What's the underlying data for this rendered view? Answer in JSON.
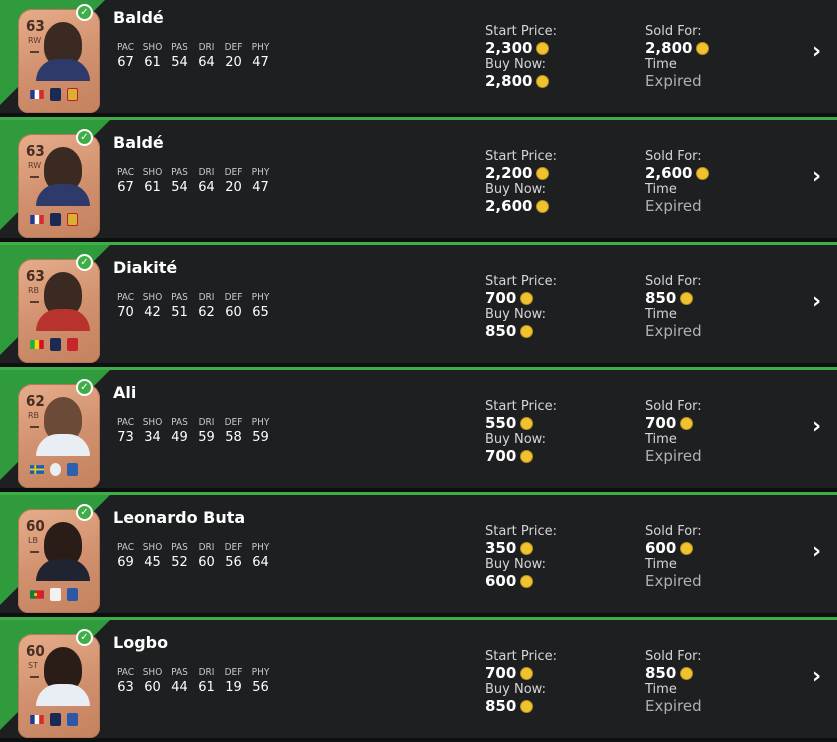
{
  "stat_labels": [
    "PAC",
    "SHO",
    "PAS",
    "DRI",
    "DEF",
    "PHY"
  ],
  "labels": {
    "start_price": "Start Price:",
    "buy_now": "Buy Now:",
    "sold_for": "Sold For:",
    "time": "Time"
  },
  "icons": {
    "coin": "coin-icon",
    "chevron": "chevron-right-icon",
    "check": "check-icon"
  },
  "colors": {
    "accent": "#3fae48",
    "row_bg": "#1d1f20",
    "coin": "#f0c230",
    "card": "#d9987a"
  },
  "items": [
    {
      "name": "Baldé",
      "rating": "63",
      "position": "RW",
      "stats": [
        "67",
        "61",
        "54",
        "64",
        "20",
        "47"
      ],
      "start_price": "2,300",
      "buy_now": "2,800",
      "sold_for": "2,800",
      "time": "Expired"
    },
    {
      "name": "Baldé",
      "rating": "63",
      "position": "RW",
      "stats": [
        "67",
        "61",
        "54",
        "64",
        "20",
        "47"
      ],
      "start_price": "2,200",
      "buy_now": "2,600",
      "sold_for": "2,600",
      "time": "Expired"
    },
    {
      "name": "Diakité",
      "rating": "63",
      "position": "RB",
      "stats": [
        "70",
        "42",
        "51",
        "62",
        "60",
        "65"
      ],
      "start_price": "700",
      "buy_now": "850",
      "sold_for": "850",
      "time": "Expired"
    },
    {
      "name": "Ali",
      "rating": "62",
      "position": "RB",
      "stats": [
        "73",
        "34",
        "49",
        "59",
        "58",
        "59"
      ],
      "start_price": "550",
      "buy_now": "700",
      "sold_for": "700",
      "time": "Expired"
    },
    {
      "name": "Leonardo Buta",
      "rating": "60",
      "position": "LB",
      "stats": [
        "69",
        "45",
        "52",
        "60",
        "56",
        "64"
      ],
      "start_price": "350",
      "buy_now": "600",
      "sold_for": "600",
      "time": "Expired"
    },
    {
      "name": "Logbo",
      "rating": "60",
      "position": "ST",
      "stats": [
        "63",
        "60",
        "44",
        "61",
        "19",
        "56"
      ],
      "start_price": "700",
      "buy_now": "850",
      "sold_for": "850",
      "time": "Expired"
    }
  ]
}
